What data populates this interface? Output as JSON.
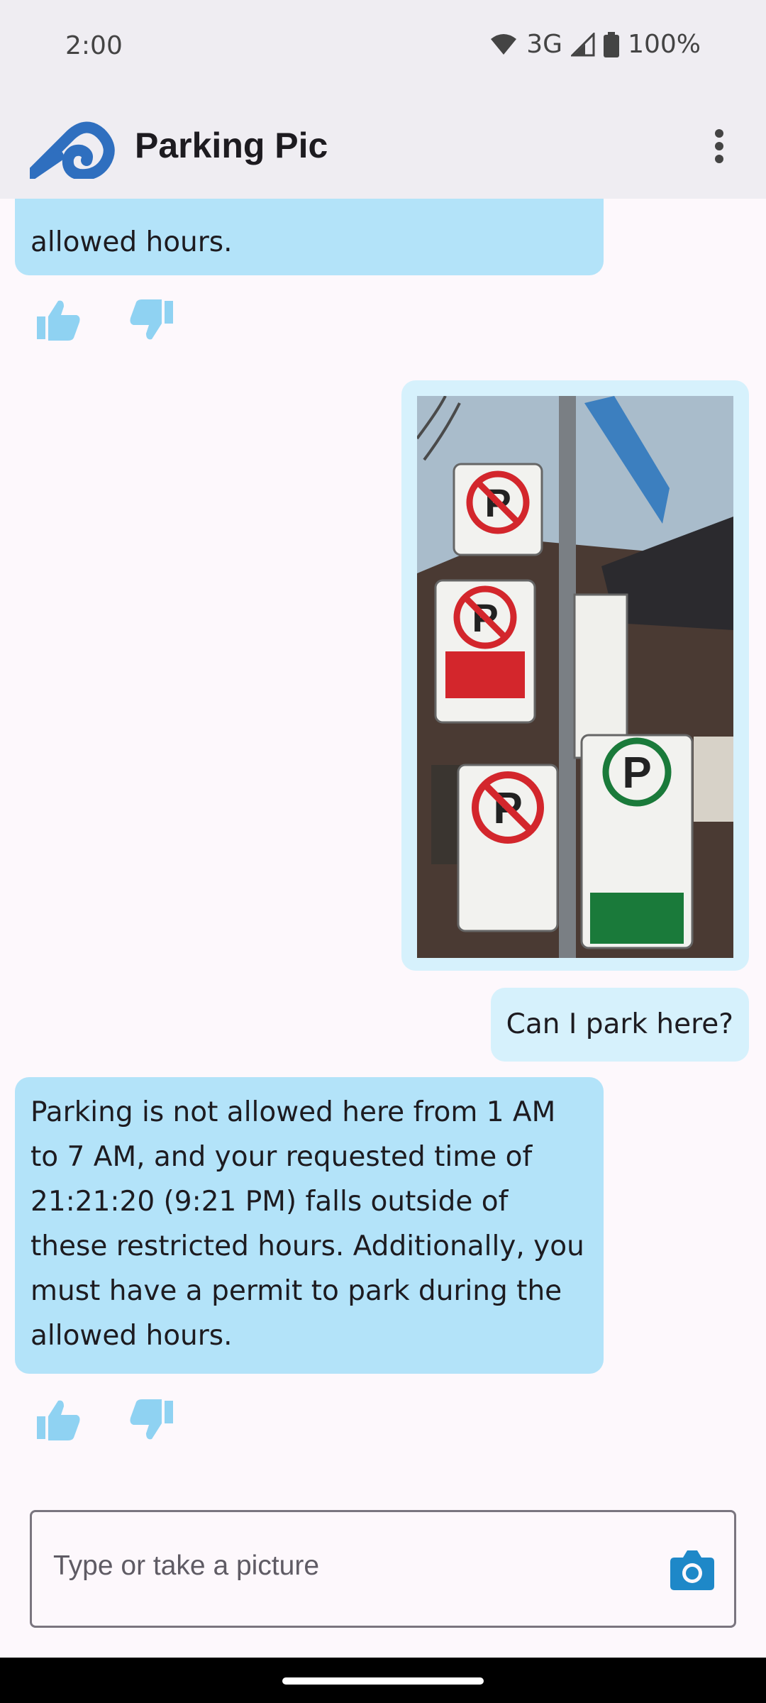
{
  "status_bar": {
    "time": "2:00",
    "network": "3G",
    "battery": "100%"
  },
  "app_bar": {
    "title": "Parking Pic",
    "logo_icon": "parking-pic-logo-icon",
    "menu_icon": "more-vert-icon"
  },
  "chat": {
    "previous_bot_tail": "allowed hours.",
    "photo_icon": "parking-signs-photo",
    "user_message": "Can I park here?",
    "bot_message": "Parking is not allowed here from 1 AM to 7 AM, and your requested time of 21:21:20 (9:21 PM) falls outside of these restricted hours. Additionally, you must have a permit to park during the allowed hours.",
    "feedback_icons": [
      "thumb-up-icon",
      "thumb-down-icon"
    ]
  },
  "input": {
    "placeholder": "Type or take a picture",
    "camera_icon": "camera-icon"
  },
  "colors": {
    "bot_bubble": "#b3e3f9",
    "user_bubble": "#d6f1fc",
    "accent": "#1e88c8",
    "logo_blue": "#2f6fbf",
    "feedback_icon": "#8fd2f2",
    "app_bar": "#efedf2"
  }
}
